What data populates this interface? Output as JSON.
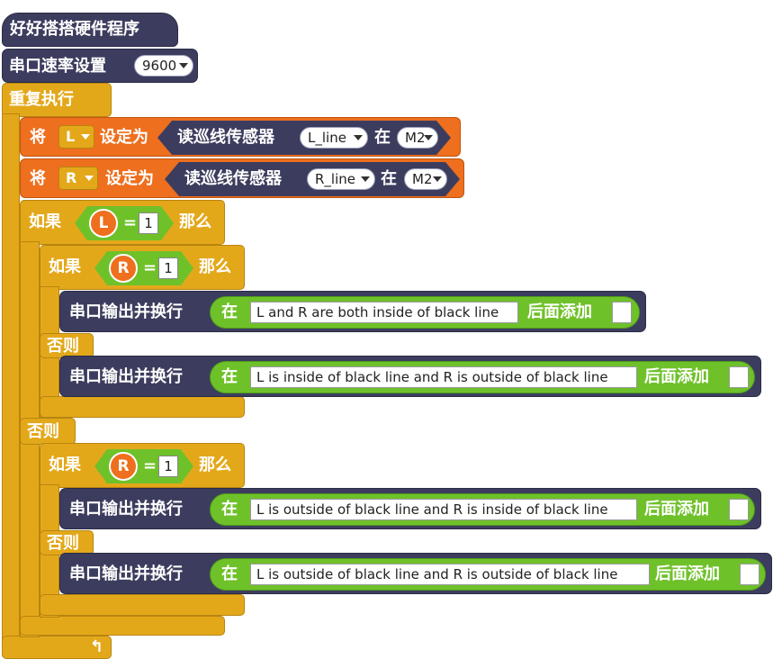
{
  "hat": {
    "label": "好好搭搭硬件程序"
  },
  "serial_rate": {
    "label": "串口速率设置",
    "value": "9600"
  },
  "loop": {
    "label": "重复执行"
  },
  "set_l": {
    "label_a": "将",
    "var": "L",
    "label_b": "设定为",
    "reader": "读巡线传感器",
    "sensor": "L_line",
    "at": "在",
    "port": "M2"
  },
  "set_r": {
    "label_a": "将",
    "var": "R",
    "label_b": "设定为",
    "reader": "读巡线传感器",
    "sensor": "R_line",
    "at": "在",
    "port": "M2"
  },
  "if_l": {
    "label_if": "如果",
    "var": "L",
    "op": "=",
    "value": "1",
    "label_then": "那么",
    "label_else": "否则"
  },
  "if_r1": {
    "label_if": "如果",
    "var": "R",
    "op": "=",
    "value": "1",
    "label_then": "那么",
    "label_else": "否则"
  },
  "if_r2": {
    "label_if": "如果",
    "var": "R",
    "op": "=",
    "value": "1",
    "label_then": "那么",
    "label_else": "否则"
  },
  "print1": {
    "label": "串口输出并换行",
    "at": "在",
    "text": "L and R are both inside of black line",
    "append": "后面添加"
  },
  "print2": {
    "label": "串口输出并换行",
    "at": "在",
    "text": "L is inside of black line and R is outside of black line",
    "append": "后面添加"
  },
  "print3": {
    "label": "串口输出并换行",
    "at": "在",
    "text": "L is outside of black line and R is inside of black line",
    "append": "后面添加"
  },
  "print4": {
    "label": "串口输出并换行",
    "at": "在",
    "text": "L is outside of black line and R is outside of black line",
    "append": "后面添加"
  },
  "icons": {
    "loop_arrow": "loop-arrow-icon",
    "dropdown": "caret-down-icon"
  },
  "colors": {
    "events": "#3c3d5e",
    "control": "#e3a81a",
    "data": "#ee6f1e",
    "operators": "#6fc12a"
  }
}
